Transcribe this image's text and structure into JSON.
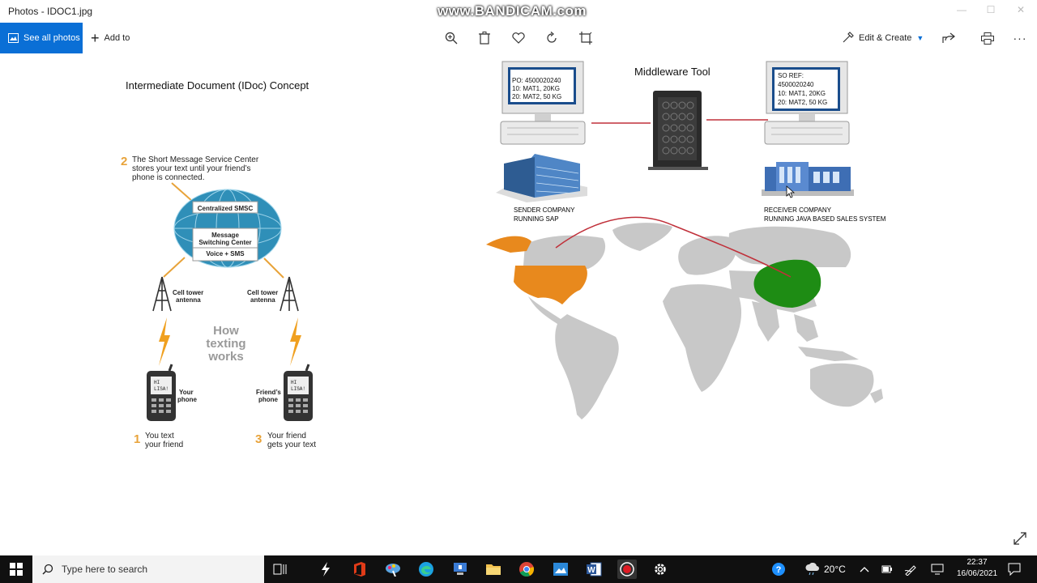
{
  "window": {
    "title": "Photos - IDOC1.jpg",
    "watermark": "www.BANDICAM.com"
  },
  "toolbar": {
    "see_all_photos": "See all photos",
    "add_to": "Add to",
    "edit_create": "Edit & Create"
  },
  "image": {
    "doc_title": "Intermediate Document (IDoc) Concept",
    "sms": {
      "step2": "2",
      "step2_text_line1": "The Short Message Service Center",
      "step2_text_line2": "stores your text until your friend’s",
      "step2_text_line3": "phone is connected.",
      "centralized": "Centralized SMSC",
      "msc_line1": "Message",
      "msc_line2": "Switching Center",
      "voice_sms": "Voice + SMS",
      "cell_tower_1_line1": "Cell tower",
      "cell_tower_1_line2": "antenna",
      "cell_tower_2_line1": "Cell tower",
      "cell_tower_2_line2": "antenna",
      "how_line1": "How",
      "how_line2": "texting",
      "how_line3": "works",
      "your_phone_line1": "Your",
      "your_phone_line2": "phone",
      "friends_phone_line1": "Friend’s",
      "friends_phone_line2": "phone",
      "phone_screen_line1": "HI",
      "phone_screen_line2": "LISA!",
      "step1": "1",
      "step1_line1": "You text",
      "step1_line2": "your friend",
      "step3": "3",
      "step3_line1": "Your friend",
      "step3_line2": "gets your text"
    },
    "middleware_title": "Middleware Tool",
    "sender_screen": [
      "PO: 4500020240",
      "10:  MAT1,  20KG",
      "20:  MAT2,  50 KG"
    ],
    "receiver_screen": [
      "SO REF:",
      "4500020240",
      "10:  MAT1,  20KG",
      "20:  MAT2,  50 KG"
    ],
    "sender_label_line1": "SENDER COMPANY",
    "sender_label_line2": "RUNNING SAP",
    "receiver_label_line1": "RECEIVER COMPANY",
    "receiver_label_line2": "RUNNING JAVA BASED SALES SYSTEM"
  },
  "taskbar": {
    "search_placeholder": "Type here to search",
    "temperature": "20°C",
    "time": "22:37",
    "date": "16/06/2021"
  },
  "colors": {
    "accent": "#0a6fd6",
    "usa": "#e8891d",
    "china": "#1e8c14",
    "route": "#c0303a",
    "map_land": "#c8c8c8",
    "globe": "#2f8fb8"
  }
}
